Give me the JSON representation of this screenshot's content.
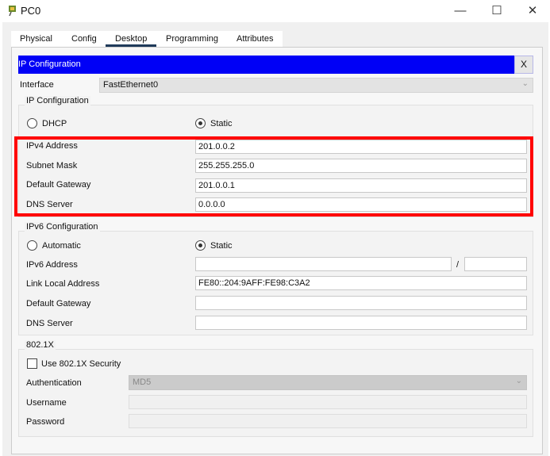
{
  "window": {
    "title": "PC0",
    "minimize": "—",
    "maximize": "☐",
    "close": "✕"
  },
  "tabs": [
    "Physical",
    "Config",
    "Desktop",
    "Programming",
    "Attributes"
  ],
  "active_tab": "Desktop",
  "ipconfig": {
    "title": "IP Configuration",
    "close": "X",
    "interface_label": "Interface",
    "interface_value": "FastEthernet0",
    "ipv4_group": "IP Configuration",
    "dhcp": "DHCP",
    "static": "Static",
    "ipv4_label": "IPv4 Address",
    "ipv4_value": "201.0.0.2",
    "mask_label": "Subnet Mask",
    "mask_value": "255.255.255.0",
    "gateway_label": "Default Gateway",
    "gateway_value": "201.0.0.1",
    "dns_label": "DNS Server",
    "dns_value": "0.0.0.0",
    "ipv6_group": "IPv6 Configuration",
    "automatic": "Automatic",
    "static6": "Static",
    "ipv6_label": "IPv6 Address",
    "ipv6_value": "",
    "slash": "/",
    "prefix_value": "",
    "linklocal_label": "Link Local Address",
    "linklocal_value": "FE80::204:9AFF:FE98:C3A2",
    "gateway6_label": "Default Gateway",
    "gateway6_value": "",
    "dns6_label": "DNS Server",
    "dns6_value": "",
    "dot1x_group": "802.1X",
    "use_security": "Use 802.1X Security",
    "auth_label": "Authentication",
    "auth_value": "MD5",
    "username_label": "Username",
    "username_value": "",
    "password_label": "Password",
    "password_value": ""
  }
}
